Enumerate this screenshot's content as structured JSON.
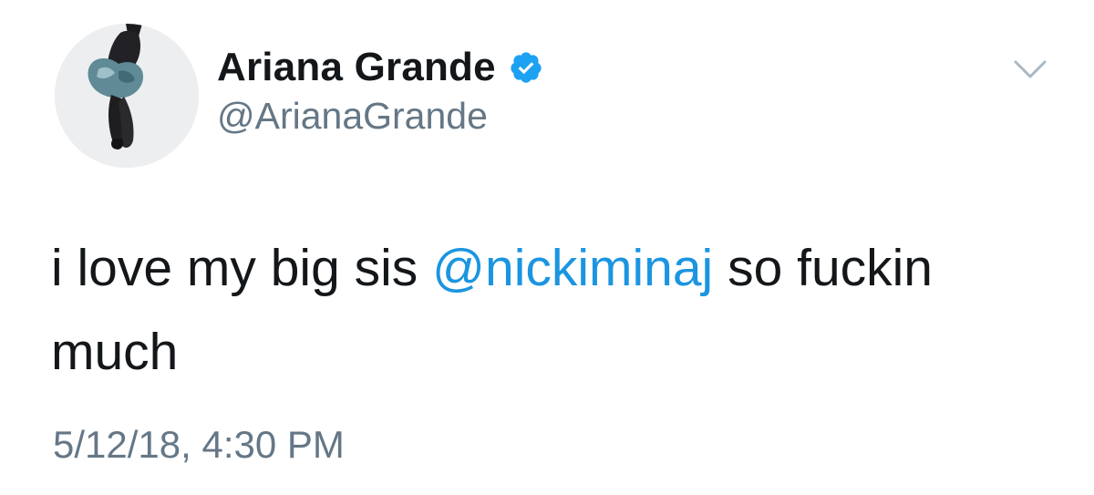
{
  "author": {
    "display_name": "Ariana Grande",
    "handle": "@ArianaGrande",
    "verified": true
  },
  "tweet": {
    "text_before": "i love my big sis ",
    "mention": "@nickiminaj",
    "text_after": " so fuckin much"
  },
  "timestamp": "5/12/18, 4:30 PM",
  "icons": {
    "verified": "verified-badge-icon",
    "menu": "chevron-down-icon"
  },
  "colors": {
    "name": "#14171a",
    "secondary": "#657786",
    "mention": "#1b95e0",
    "verified": "#1da1f2"
  }
}
